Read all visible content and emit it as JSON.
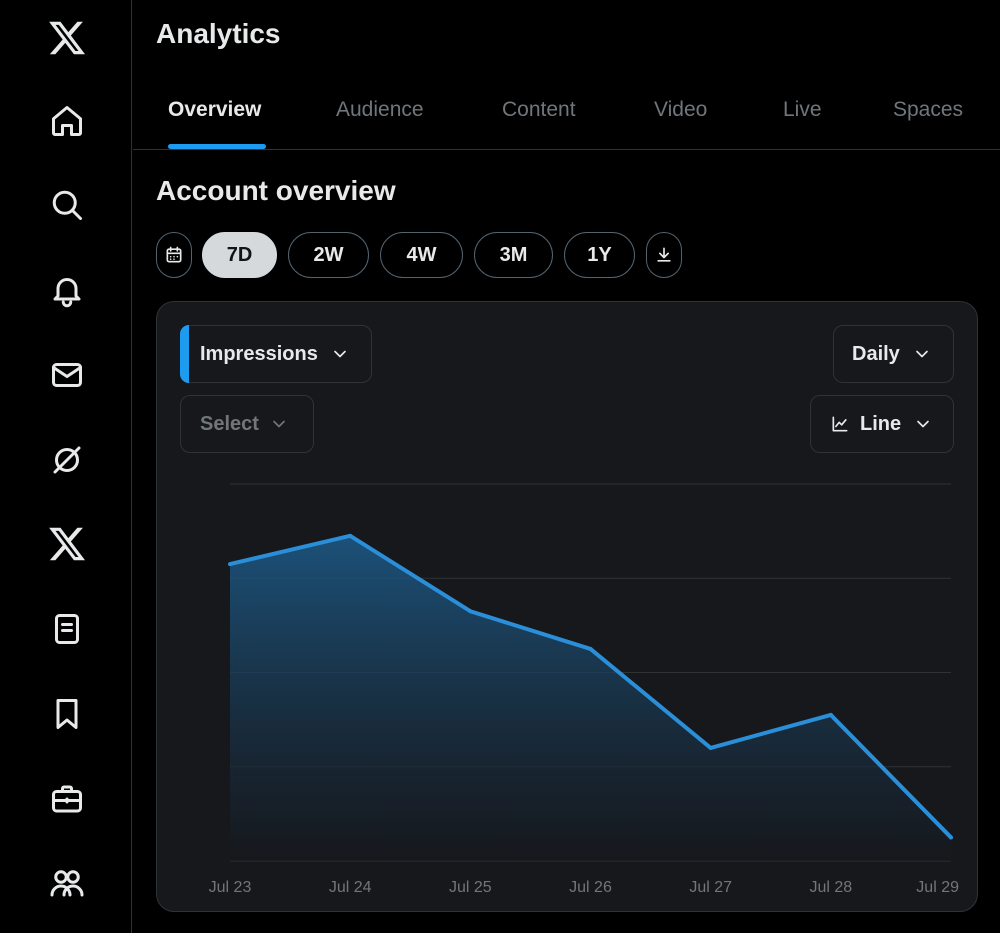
{
  "sidebar": {
    "items": [
      {
        "icon": "x-logo-icon"
      },
      {
        "icon": "home-icon"
      },
      {
        "icon": "search-icon"
      },
      {
        "icon": "bell-icon"
      },
      {
        "icon": "mail-icon"
      },
      {
        "icon": "grok-icon"
      },
      {
        "icon": "x-premium-icon"
      },
      {
        "icon": "lists-icon"
      },
      {
        "icon": "bookmark-icon"
      },
      {
        "icon": "briefcase-icon"
      },
      {
        "icon": "communities-icon"
      }
    ]
  },
  "header": {
    "title": "Analytics"
  },
  "tabs": [
    {
      "label": "Overview",
      "active": true
    },
    {
      "label": "Audience",
      "active": false
    },
    {
      "label": "Content",
      "active": false
    },
    {
      "label": "Video",
      "active": false
    },
    {
      "label": "Live",
      "active": false
    },
    {
      "label": "Spaces",
      "active": false
    }
  ],
  "section": {
    "title": "Account overview"
  },
  "ranges": {
    "calendar_icon": "calendar-icon",
    "options": [
      "7D",
      "2W",
      "4W",
      "3M",
      "1Y"
    ],
    "selected": "7D",
    "download_icon": "download-icon"
  },
  "controls": {
    "metric": "Impressions",
    "compare": "Select",
    "interval": "Daily",
    "chart_type": "Line"
  },
  "colors": {
    "accent": "#1d9bf0",
    "line": "#2a8fd8",
    "card_bg": "#16181c",
    "border": "#2f3336"
  },
  "chart_data": {
    "type": "area",
    "x": [
      "Jul 23",
      "Jul 24",
      "Jul 25",
      "Jul 26",
      "Jul 27",
      "Jul 28",
      "Jul 29"
    ],
    "series": [
      {
        "values": [
          3.15,
          3.45,
          2.65,
          2.25,
          1.2,
          1.55,
          0.25
        ]
      }
    ],
    "ylim": [
      0,
      4
    ],
    "gridlines": 5,
    "grid": true,
    "ytick_labels": false
  }
}
